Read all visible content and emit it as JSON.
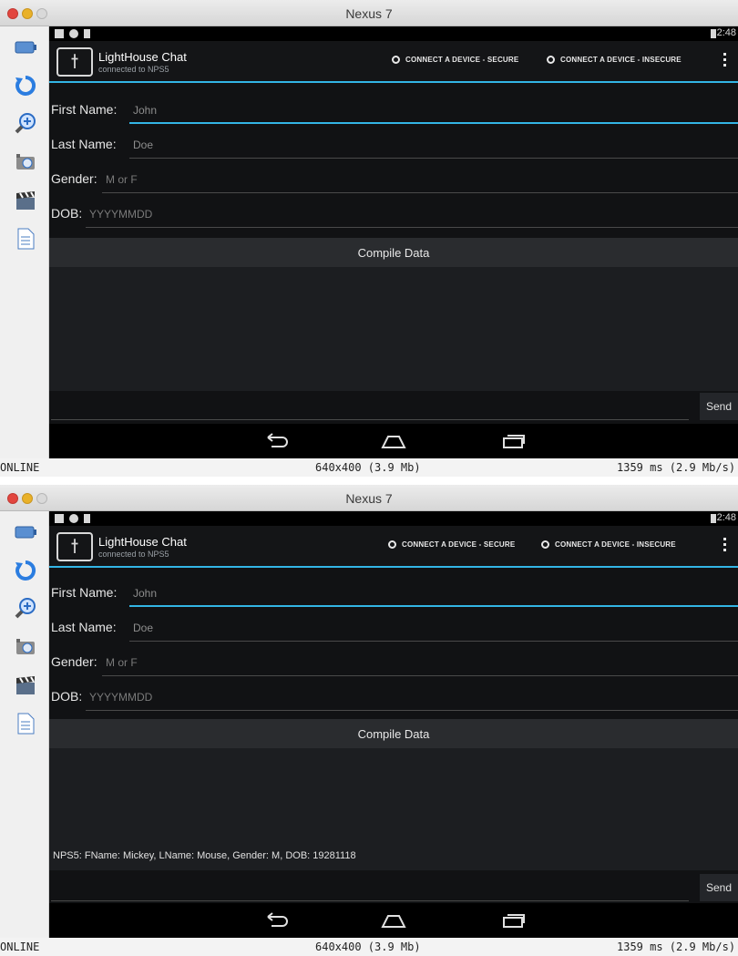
{
  "windows": [
    {
      "title": "Nexus 7",
      "status_clock": "2:48",
      "app": {
        "title": "LightHouse Chat",
        "subtitle": "connected to NPS5"
      },
      "actions": [
        "CONNECT A DEVICE - SECURE",
        "CONNECT A DEVICE - INSECURE"
      ],
      "form": [
        {
          "label": "First Name:",
          "value": "John",
          "placeholder": ""
        },
        {
          "label": "Last Name:",
          "value": "Doe",
          "placeholder": ""
        },
        {
          "label": "Gender:",
          "value": "",
          "placeholder": "M or F"
        },
        {
          "label": "DOB:",
          "value": "",
          "placeholder": "YYYYMMDD"
        }
      ],
      "compile_label": "Compile Data",
      "messages": [],
      "send_label": "Send",
      "footer": {
        "left": "ONLINE",
        "center": "640x400 (3.9 Mb)",
        "right": "1359 ms (2.9 Mb/s)"
      }
    },
    {
      "title": "Nexus 7",
      "status_clock": "2:48",
      "app": {
        "title": "LightHouse Chat",
        "subtitle": "connected to NPS5"
      },
      "actions": [
        "CONNECT A DEVICE - SECURE",
        "CONNECT A DEVICE - INSECURE"
      ],
      "form": [
        {
          "label": "First Name:",
          "value": "John",
          "placeholder": ""
        },
        {
          "label": "Last Name:",
          "value": "Doe",
          "placeholder": ""
        },
        {
          "label": "Gender:",
          "value": "",
          "placeholder": "M or F"
        },
        {
          "label": "DOB:",
          "value": "",
          "placeholder": "YYYYMMDD"
        }
      ],
      "compile_label": "Compile Data",
      "messages": [
        "NPS5:  FName: Mickey, LName: Mouse, Gender: M, DOB: 19281118"
      ],
      "send_label": "Send",
      "footer": {
        "left": "ONLINE",
        "center": "640x400 (3.9 Mb)",
        "right": "1359 ms (2.9 Mb/s)"
      }
    }
  ]
}
